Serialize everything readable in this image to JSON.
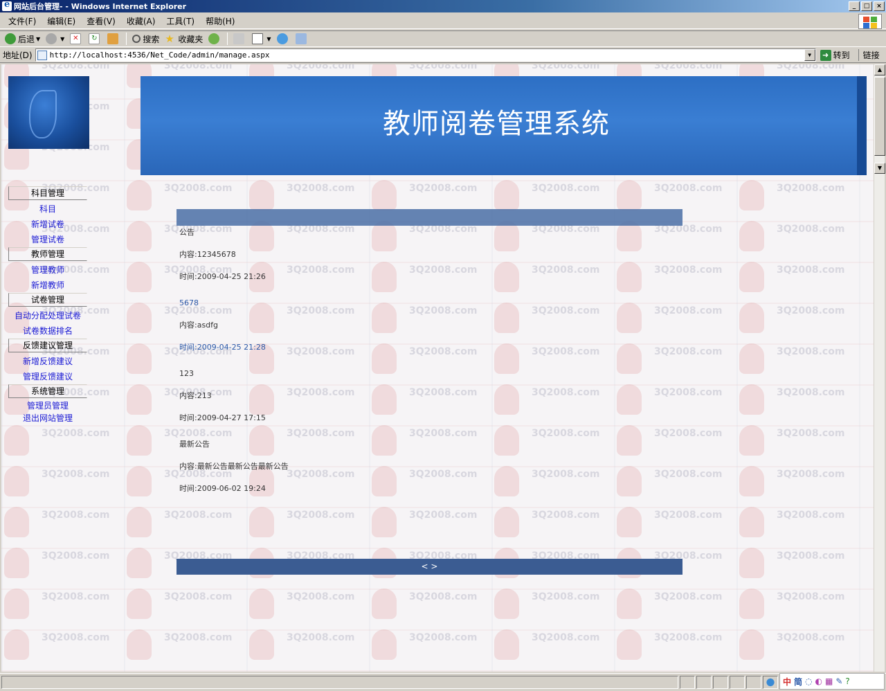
{
  "window": {
    "title": "网站后台管理- - Windows Internet Explorer",
    "controls": [
      "_",
      "□",
      "×"
    ]
  },
  "menubar": {
    "items": [
      "文件(F)",
      "编辑(E)",
      "查看(V)",
      "收藏(A)",
      "工具(T)",
      "帮助(H)"
    ]
  },
  "toolbar": {
    "back_label": "后退",
    "search_label": "搜索",
    "favorites_label": "收藏夹"
  },
  "addressbar": {
    "label": "地址(D)",
    "url": "http://localhost:4536/Net_Code/admin/manage.aspx",
    "go_label": "转到",
    "links_label": "链接"
  },
  "banner": {
    "title": "教师阅卷管理系统"
  },
  "sidebar": {
    "groups": [
      {
        "heading": "科目管理",
        "links": [
          "科目",
          "新增试卷",
          "管理试卷"
        ]
      },
      {
        "heading": "教师管理",
        "links": [
          "管理教师",
          "新增教师"
        ]
      },
      {
        "heading": "试卷管理",
        "links": [
          "自动分配处理试卷",
          "试卷数据排名"
        ]
      },
      {
        "heading": "反馈建议管理",
        "links": [
          "新增反馈建议",
          "管理反馈建议"
        ]
      },
      {
        "heading": "系统管理",
        "links": [
          "管理员管理",
          "退出网站管理"
        ]
      }
    ]
  },
  "notices": [
    {
      "title": "公告",
      "content": "内容:12345678",
      "time": "时间:2009-04-25 21:26"
    },
    {
      "title": "5678",
      "content": "内容:asdfg",
      "time": "时间:2009-04-25 21:28"
    },
    {
      "title": "123",
      "content": "内容:213",
      "time": "时间:2009-04-27 17:15"
    },
    {
      "title": "最新公告",
      "content": "内容:最新公告最新公告最新公告",
      "time": "时间:2009-06-02 19:24"
    }
  ],
  "notice_footer": {
    "nav": "< >"
  },
  "watermark": {
    "text": "3Q2008.com"
  },
  "ime": {
    "lang": "中",
    "mode": "简"
  }
}
